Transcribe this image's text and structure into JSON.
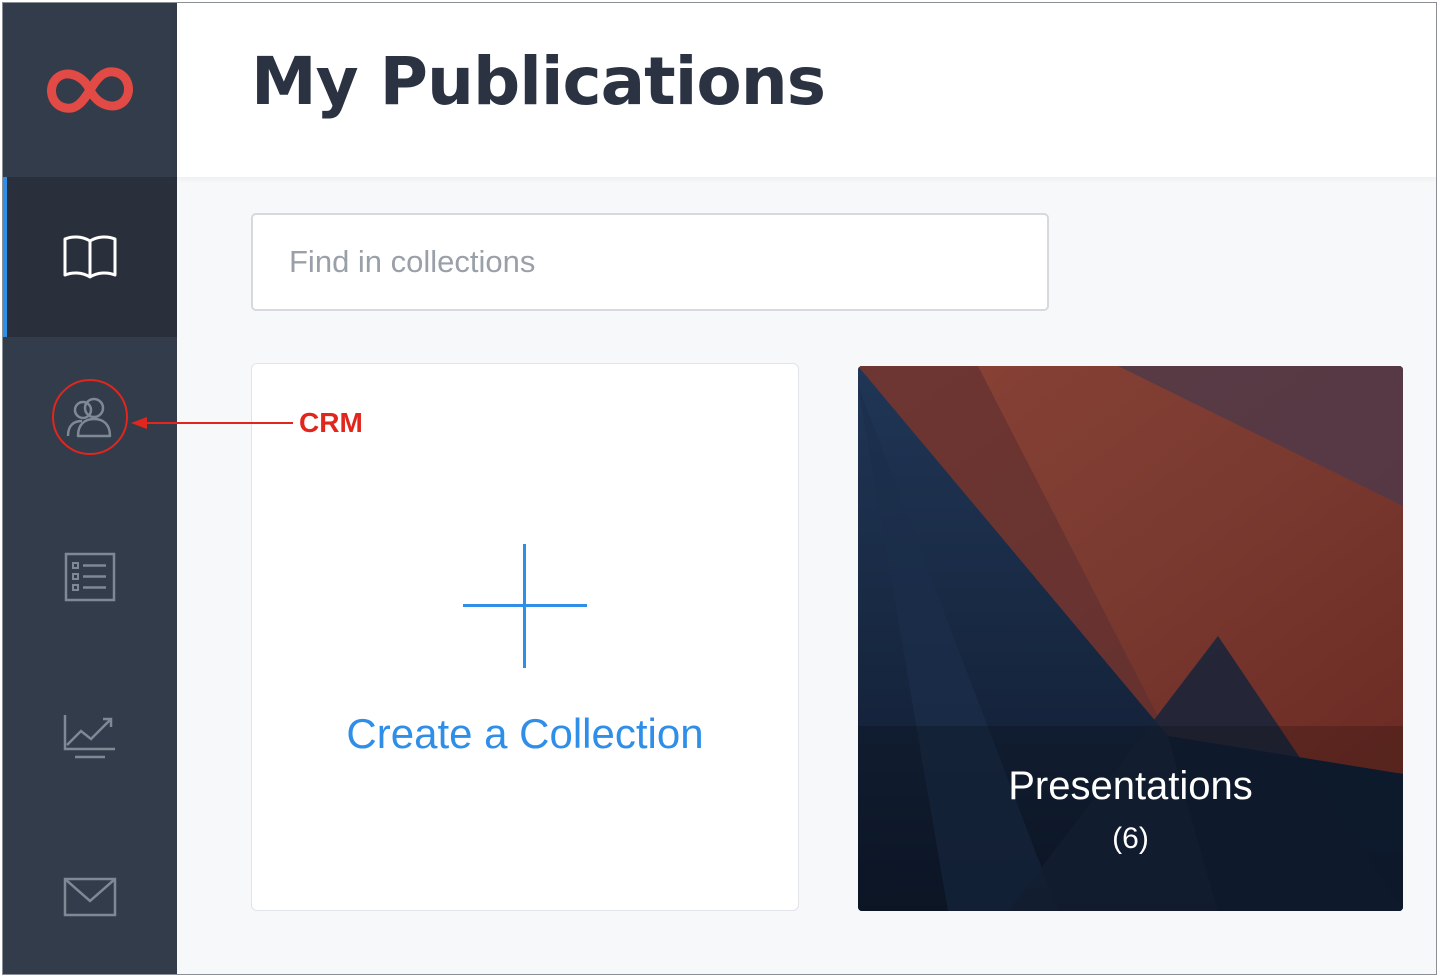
{
  "header": {
    "title": "My Publications"
  },
  "search": {
    "placeholder": "Find in collections",
    "value": ""
  },
  "sidebar": {
    "logo_icon": "infinity-logo-icon",
    "brand_color": "#e24a45",
    "items": [
      {
        "id": "publications",
        "icon": "open-book-icon",
        "active": true
      },
      {
        "id": "crm",
        "icon": "users-icon",
        "active": false,
        "highlighted": true
      },
      {
        "id": "forms",
        "icon": "checklist-icon",
        "active": false
      },
      {
        "id": "analytics",
        "icon": "line-chart-icon",
        "active": false
      },
      {
        "id": "email",
        "icon": "envelope-icon",
        "active": false
      }
    ]
  },
  "create_card": {
    "label": "Create a Collection",
    "icon": "plus-icon",
    "accent": "#2f8fe8"
  },
  "collections": [
    {
      "name": "Presentations",
      "count": "(6)"
    }
  ],
  "annotation": {
    "label": "CRM",
    "color": "#e0261d"
  }
}
